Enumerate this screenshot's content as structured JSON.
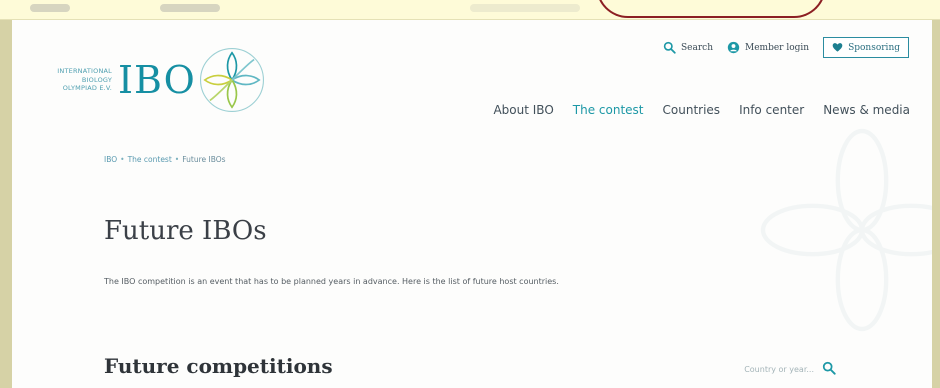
{
  "logo": {
    "line1": "INTERNATIONAL",
    "line2": "BIOLOGY",
    "line3": "OLYMPIAD e.V.",
    "wordmark": "IBO"
  },
  "utility_nav": {
    "search_label": "Search",
    "member_login_label": "Member login",
    "sponsoring_label": "Sponsoring"
  },
  "main_nav": [
    {
      "label": "About IBO",
      "active": false
    },
    {
      "label": "The contest",
      "active": true
    },
    {
      "label": "Countries",
      "active": false
    },
    {
      "label": "Info center",
      "active": false
    },
    {
      "label": "News & media",
      "active": false
    }
  ],
  "breadcrumb": {
    "items": [
      "IBO",
      "The contest",
      "Future IBOs"
    ],
    "separator": "•"
  },
  "page": {
    "title": "Future IBOs",
    "intro": "The IBO competition is an event that has to be planned years in advance. Here is the list of future host countries."
  },
  "section": {
    "title": "Future competitions"
  },
  "search": {
    "placeholder": "Country or year..."
  },
  "colors": {
    "accent": "#1d98a6",
    "text_dark": "#3b4047",
    "background": "#fdfdfc",
    "outer_frame": "#d6d2a6",
    "annotation_red": "#8c1f23"
  }
}
